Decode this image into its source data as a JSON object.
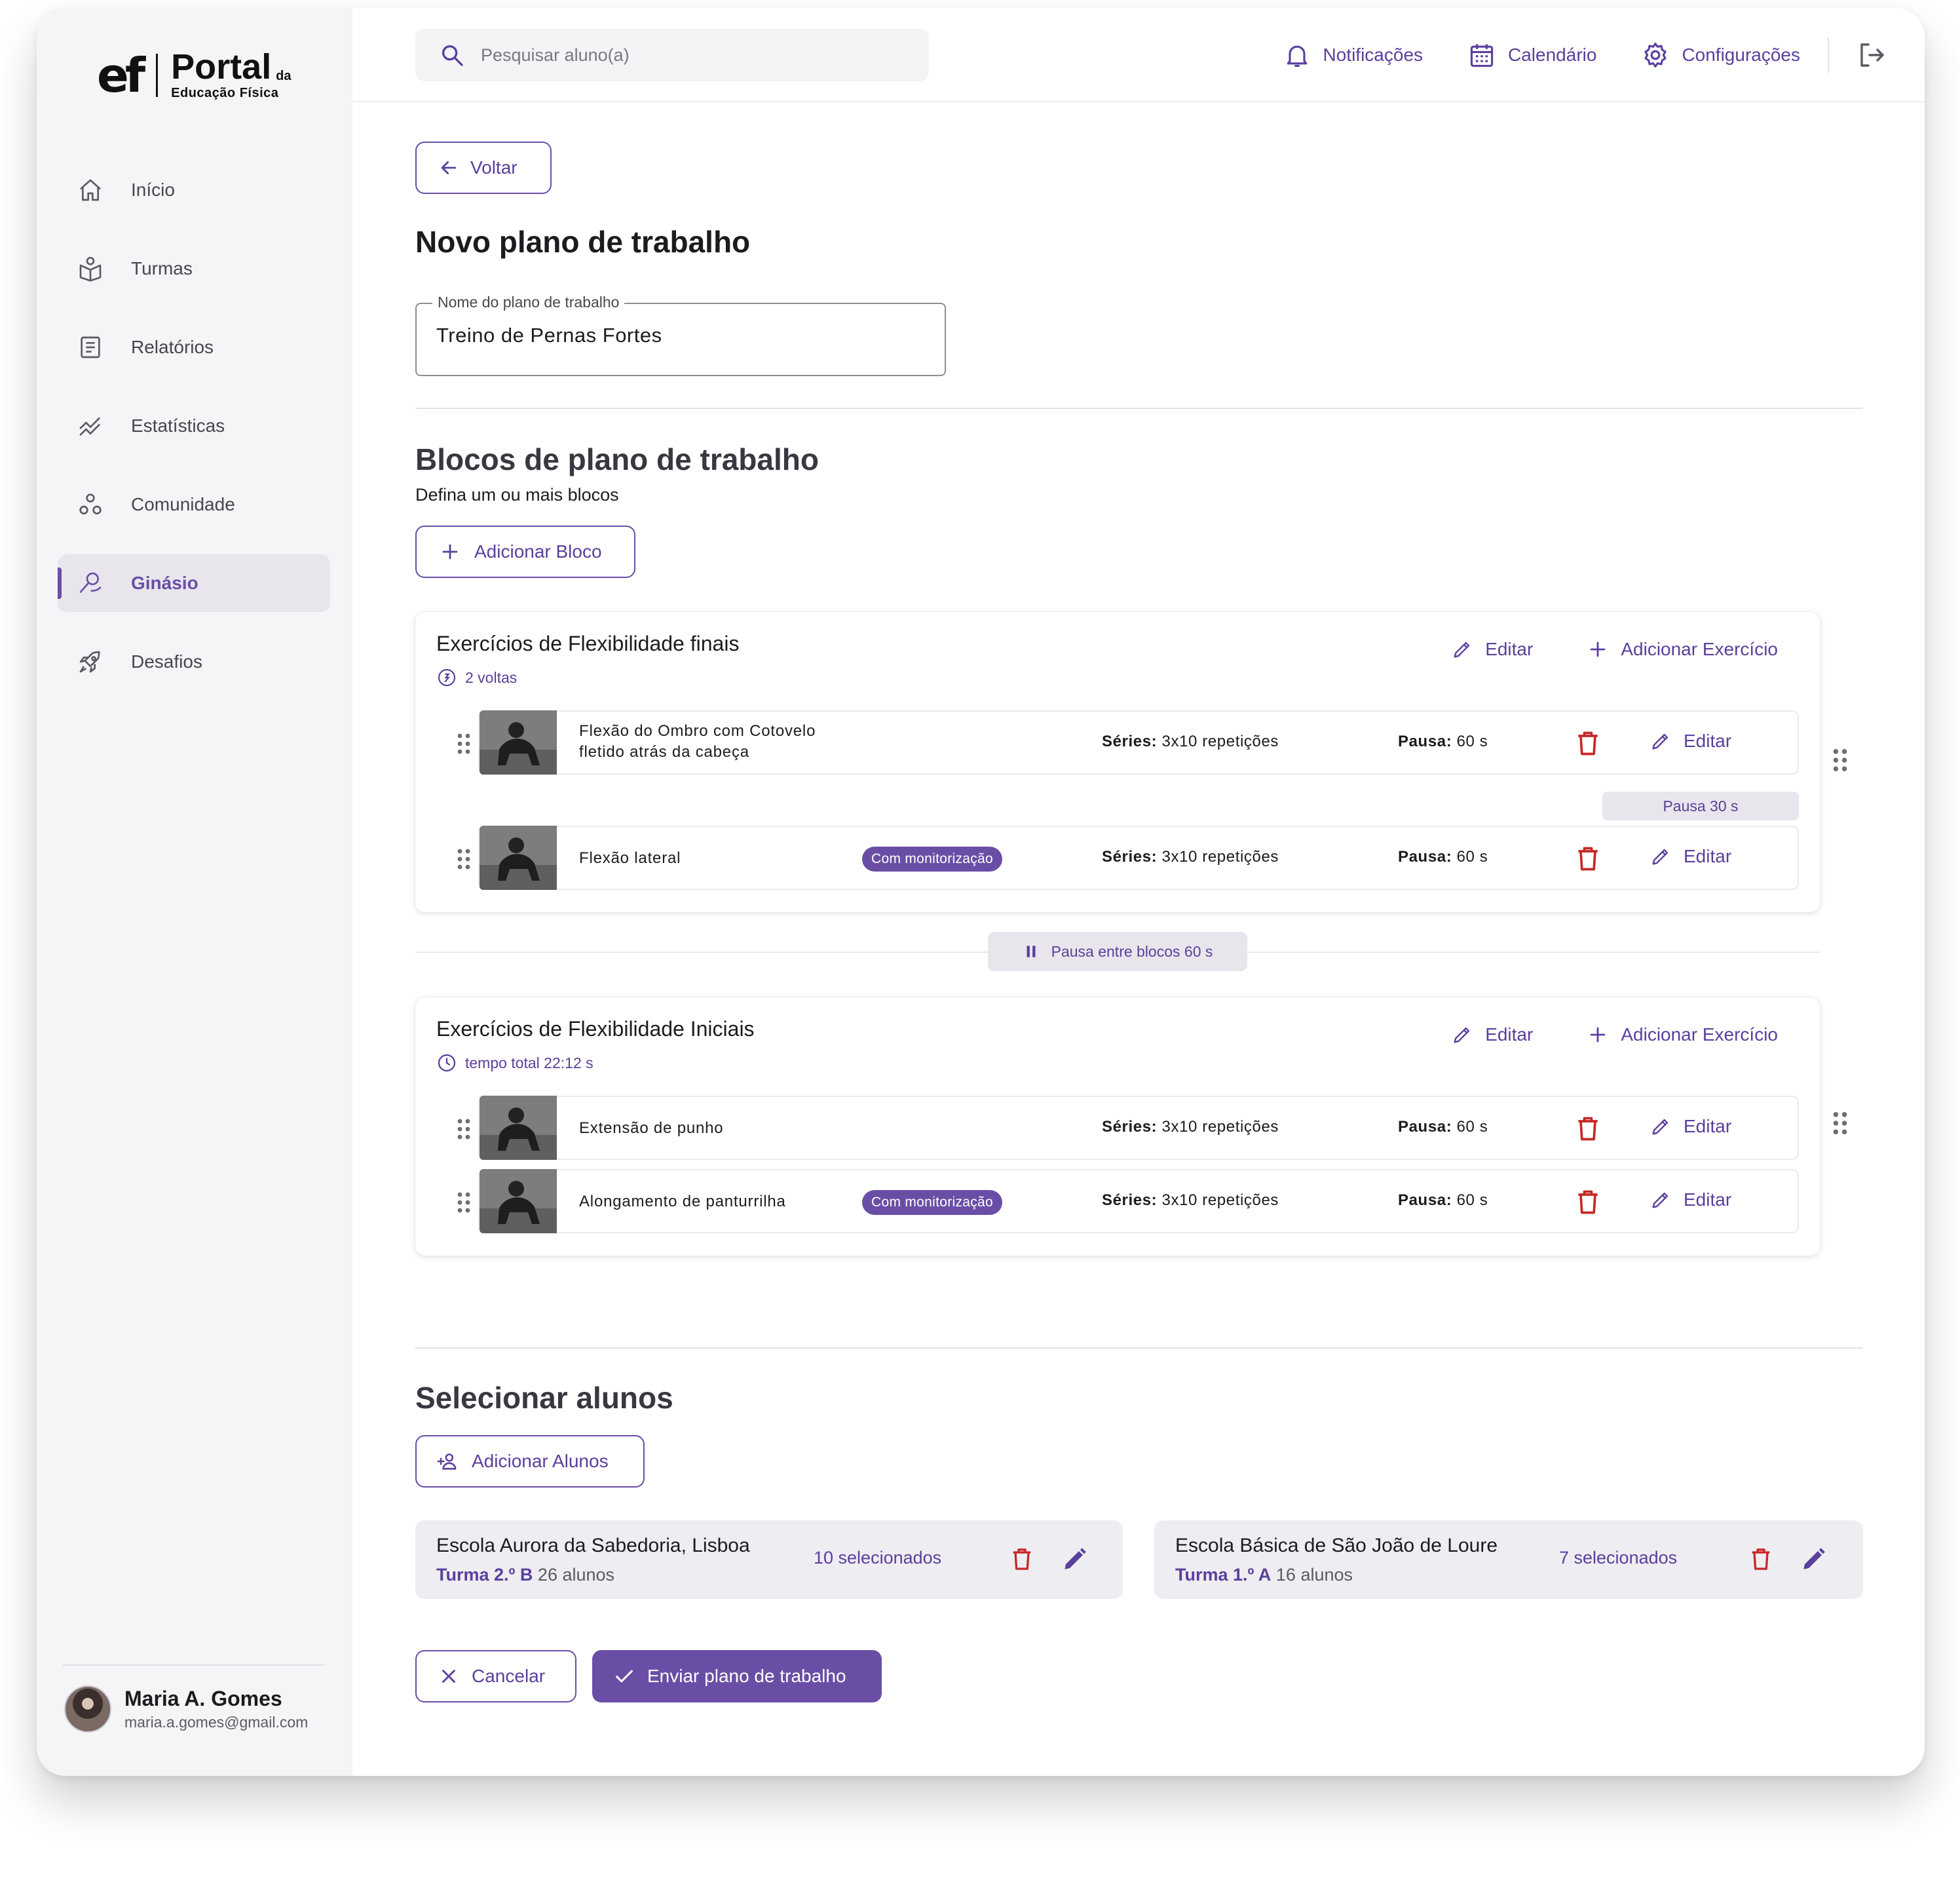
{
  "brand": {
    "logo_mark": "ef",
    "logo_name": "Portal",
    "logo_da": "da",
    "logo_sub": "Educação Física"
  },
  "sidebar": {
    "items": [
      {
        "label": "Início",
        "icon": "home-icon"
      },
      {
        "label": "Turmas",
        "icon": "class-icon"
      },
      {
        "label": "Relatórios",
        "icon": "report-icon"
      },
      {
        "label": "Estatísticas",
        "icon": "stats-icon"
      },
      {
        "label": "Comunidade",
        "icon": "community-icon"
      },
      {
        "label": "Ginásio",
        "icon": "gym-icon",
        "active": true
      },
      {
        "label": "Desafios",
        "icon": "rocket-icon"
      }
    ],
    "profile": {
      "name": "Maria A. Gomes",
      "email": "maria.a.gomes@gmail.com"
    }
  },
  "topbar": {
    "search_placeholder": "Pesquisar aluno(a)",
    "notifications": "Notificações",
    "calendar": "Calendário",
    "settings": "Configurações"
  },
  "page": {
    "back_label": "Voltar",
    "title": "Novo plano de trabalho",
    "name_field_label": "Nome do plano de trabalho",
    "name_field_value": "Treino de Pernas Fortes"
  },
  "blocks_section": {
    "title": "Blocos de plano de trabalho",
    "subtitle": "Defina um ou mais blocos",
    "add_block_label": "Adicionar Bloco",
    "edit_label": "Editar",
    "add_exercise_label": "Adicionar Exercício",
    "series_key": "Séries:",
    "pause_key": "Pausa:",
    "between_blocks_pause": "Pausa entre blocos 60 s",
    "blocks": [
      {
        "title": "Exercícios de Flexibilidade finais",
        "meta": "2 voltas",
        "meta_icon": "rounds-icon",
        "intra_pause": "Pausa 30 s",
        "exercises": [
          {
            "name_line1": "Flexão do Ombro com Cotovelo",
            "name_line2": "fletido atrás da cabeça",
            "badge": "",
            "series": "3x10 repetições",
            "pause": "60 s"
          },
          {
            "name_line1": "Flexão lateral",
            "name_line2": "",
            "badge": "Com monitorização",
            "series": "3x10 repetições",
            "pause": "60 s"
          }
        ]
      },
      {
        "title": "Exercícios de Flexibilidade Iniciais",
        "meta": "tempo total 22:12 s",
        "meta_icon": "clock-icon",
        "exercises": [
          {
            "name_line1": "Extensão de punho",
            "name_line2": "",
            "badge": "",
            "series": "3x10 repetições",
            "pause": "60 s"
          },
          {
            "name_line1": "Alongamento de panturrilha",
            "name_line2": "",
            "badge": "Com monitorização",
            "series": "3x10 repetições",
            "pause": "60 s"
          }
        ]
      }
    ]
  },
  "students_section": {
    "title": "Selecionar alunos",
    "add_students_label": "Adicionar Alunos",
    "schools": [
      {
        "name": "Escola Aurora da Sabedoria, Lisboa",
        "class_label": "Turma 2.º B",
        "students": "26 alunos",
        "selected": "10 selecionados"
      },
      {
        "name": "Escola Básica de São João de Loure",
        "class_label": "Turma 1.º A",
        "students": "16 alunos",
        "selected": "7 selecionados"
      }
    ]
  },
  "footer_actions": {
    "cancel_label": "Cancelar",
    "submit_label": "Enviar plano de trabalho"
  },
  "colors": {
    "accent": "#6a4ea6",
    "accent_text": "#5b3f9c",
    "danger": "#c62828",
    "sidebar_bg": "#f5f4f6",
    "school_card_bg": "#eeedf2"
  }
}
